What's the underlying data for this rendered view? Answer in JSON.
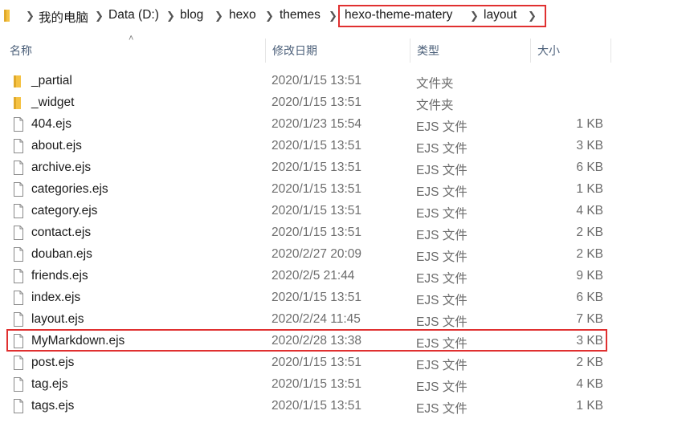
{
  "address_bar": {
    "crumbs": [
      "我的电脑",
      "Data (D:)",
      "blog",
      "hexo",
      "themes",
      "hexo-theme-matery",
      "layout"
    ]
  },
  "columns": {
    "name": "名称",
    "modified": "修改日期",
    "type": "类型",
    "size": "大小"
  },
  "files": [
    {
      "name": "_partial",
      "modified": "2020/1/15 13:51",
      "type": "文件夹",
      "size": "",
      "kind": "folder-icon"
    },
    {
      "name": "_widget",
      "modified": "2020/1/15 13:51",
      "type": "文件夹",
      "size": "",
      "kind": "folder-icon"
    },
    {
      "name": "404.ejs",
      "modified": "2020/1/23 15:54",
      "type": "EJS 文件",
      "size": "1 KB",
      "kind": "file-icon"
    },
    {
      "name": "about.ejs",
      "modified": "2020/1/15 13:51",
      "type": "EJS 文件",
      "size": "3 KB",
      "kind": "file-icon"
    },
    {
      "name": "archive.ejs",
      "modified": "2020/1/15 13:51",
      "type": "EJS 文件",
      "size": "6 KB",
      "kind": "file-icon"
    },
    {
      "name": "categories.ejs",
      "modified": "2020/1/15 13:51",
      "type": "EJS 文件",
      "size": "1 KB",
      "kind": "file-icon"
    },
    {
      "name": "category.ejs",
      "modified": "2020/1/15 13:51",
      "type": "EJS 文件",
      "size": "4 KB",
      "kind": "file-icon"
    },
    {
      "name": "contact.ejs",
      "modified": "2020/1/15 13:51",
      "type": "EJS 文件",
      "size": "2 KB",
      "kind": "file-icon"
    },
    {
      "name": "douban.ejs",
      "modified": "2020/2/27 20:09",
      "type": "EJS 文件",
      "size": "2 KB",
      "kind": "file-icon"
    },
    {
      "name": "friends.ejs",
      "modified": "2020/2/5 21:44",
      "type": "EJS 文件",
      "size": "9 KB",
      "kind": "file-icon"
    },
    {
      "name": "index.ejs",
      "modified": "2020/1/15 13:51",
      "type": "EJS 文件",
      "size": "6 KB",
      "kind": "file-icon"
    },
    {
      "name": "layout.ejs",
      "modified": "2020/2/24 11:45",
      "type": "EJS 文件",
      "size": "7 KB",
      "kind": "file-icon"
    },
    {
      "name": "MyMarkdown.ejs",
      "modified": "2020/2/28 13:38",
      "type": "EJS 文件",
      "size": "3 KB",
      "kind": "file-icon"
    },
    {
      "name": "post.ejs",
      "modified": "2020/1/15 13:51",
      "type": "EJS 文件",
      "size": "2 KB",
      "kind": "file-icon"
    },
    {
      "name": "tag.ejs",
      "modified": "2020/1/15 13:51",
      "type": "EJS 文件",
      "size": "4 KB",
      "kind": "file-icon"
    },
    {
      "name": "tags.ejs",
      "modified": "2020/1/15 13:51",
      "type": "EJS 文件",
      "size": "1 KB",
      "kind": "file-icon"
    }
  ],
  "colors": {
    "highlight": "#e03030",
    "folder": "#f5c243"
  }
}
